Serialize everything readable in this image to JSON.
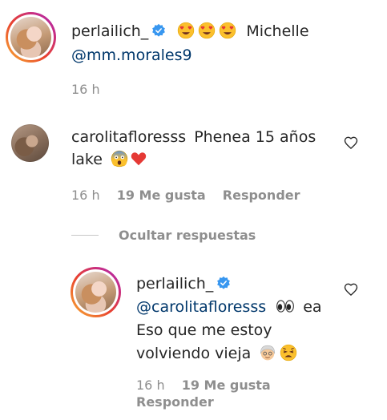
{
  "comments": [
    {
      "username": "perlailich_",
      "text_after_emojis": "Michelle",
      "mention": "@mm.morales9",
      "time": "16 h"
    },
    {
      "username": "carolitafloresss",
      "text": "Phenea 15 años",
      "text_line2": "lake",
      "time": "16 h",
      "likes": "19 Me gusta",
      "reply": "Responder"
    }
  ],
  "hide_replies": "Ocultar respuestas",
  "reply": {
    "username": "perlailich_",
    "mention": "@carolitafloresss",
    "text_after_eyes": "ea",
    "line2": "Eso que me estoy",
    "line3": "volviendo vieja",
    "time": "16 h",
    "likes": "19 Me gusta",
    "reply_action": "Responder"
  },
  "icons": {
    "verified": "verified-badge-icon",
    "heart": "heart-outline-icon",
    "emoji_heart_eyes": "heart-eyes-emoji",
    "emoji_scream": "scream-emoji",
    "emoji_red_heart": "red-heart-emoji",
    "emoji_eyes": "eyes-emoji",
    "emoji_old_woman": "old-woman-emoji",
    "emoji_weary": "weary-emoji"
  },
  "colors": {
    "text": "#262626",
    "mention": "#00376b",
    "meta": "#8e8e8e",
    "verified": "#3897f0",
    "heart_red": "#ed4956"
  }
}
